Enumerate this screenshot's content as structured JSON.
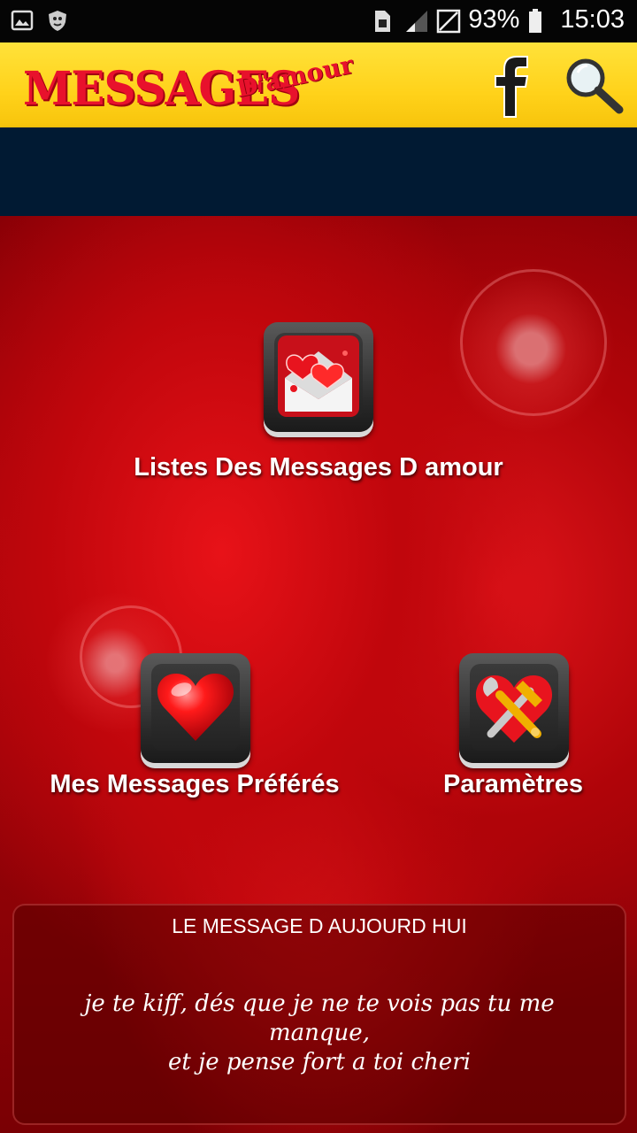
{
  "status_bar": {
    "battery": "93%",
    "time": "15:03",
    "icons": [
      "image-icon",
      "shield-icon",
      "sim-icon",
      "signal-icon",
      "no-signal-icon",
      "battery-icon"
    ]
  },
  "header": {
    "logo_main": "MESSAGES",
    "logo_sub": "D'amour",
    "facebook_glyph": "f",
    "icons": [
      "facebook-icon",
      "search-icon"
    ]
  },
  "menu": {
    "list_label": "Listes Des Messages D amour",
    "favorites_label": "Mes Messages Préférés",
    "settings_label": "Paramètres",
    "icons": [
      "hearts-envelope-icon",
      "heart-icon",
      "tools-heart-icon"
    ]
  },
  "daily_message": {
    "title": "LE MESSAGE D AUJOURD HUI",
    "line1": "je te kiff, dés que je ne te vois pas tu me manque,",
    "line2": "et je pense fort a toi cheri"
  },
  "colors": {
    "header_yellow": "#ffd21a",
    "logo_red": "#e8112c",
    "ad_band": "#011a33",
    "background_red": "#a8040a"
  }
}
